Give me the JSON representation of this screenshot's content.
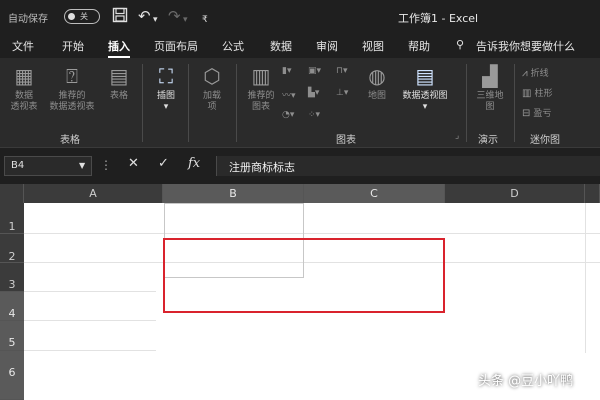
{
  "titlebar": {
    "autosave_label": "自动保存",
    "autosave_state": "关",
    "save_icon": "save-icon",
    "undo_icon": "undo-icon",
    "redo_icon": "redo-icon",
    "customize_icon": "customize-quick-access-icon",
    "doc_title": "工作簿1 - Excel"
  },
  "menubar": {
    "items": [
      {
        "label": "文件"
      },
      {
        "label": "开始"
      },
      {
        "label": "插入"
      },
      {
        "label": "页面布局"
      },
      {
        "label": "公式"
      },
      {
        "label": "数据"
      },
      {
        "label": "审阅"
      },
      {
        "label": "视图"
      },
      {
        "label": "帮助"
      }
    ],
    "active": "插入",
    "tell_me": "告诉我你想要做什么",
    "tell_me_icon": "lightbulb-search-icon"
  },
  "ribbon": {
    "tables": {
      "group_label": "表格",
      "pivot_line1": "数据",
      "pivot_line2": "透视表",
      "rec_pivot_line1": "推荐的",
      "rec_pivot_line2": "数据透视表",
      "table_label": "表格"
    },
    "illustrations": {
      "label": "插图"
    },
    "addins": {
      "line1": "加载",
      "line2": "项"
    },
    "charts": {
      "group_label": "图表",
      "rec_line1": "推荐的",
      "rec_line2": "图表",
      "maps_label": "地图",
      "pivot_chart_label": "数据透视图"
    },
    "tours": {
      "group_label": "演示",
      "line1": "三维地",
      "line2": "图"
    },
    "sparklines": {
      "group_label": "迷你图",
      "line": "折线",
      "column": "柱形",
      "winloss": "盈亏"
    }
  },
  "formulabar": {
    "name_box": "B4",
    "formula": "注册商标标志"
  },
  "grid": {
    "columns": [
      "A",
      "B",
      "C",
      "D"
    ],
    "rows": [
      "1",
      "2",
      "3",
      "4",
      "5",
      "6"
    ],
    "selected_columns": [
      "B",
      "C"
    ],
    "selected_rows": [
      "4",
      "5",
      "6"
    ]
  },
  "accent_colors": {
    "highlight_border": "#d9232d"
  },
  "watermark": "头条 @豆小吖鸭"
}
